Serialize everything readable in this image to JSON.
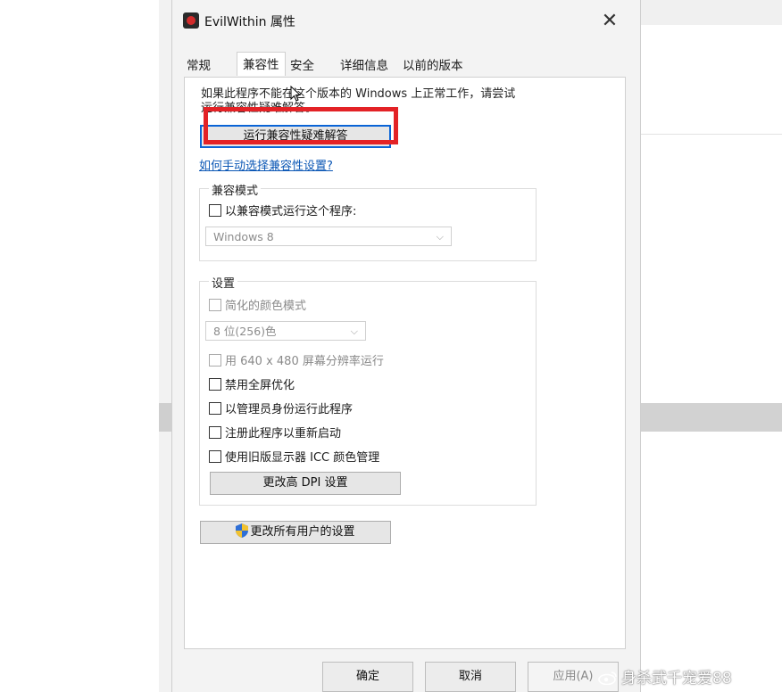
{
  "dialog": {
    "title": "EvilWithin 属性",
    "close_glyph": "✕"
  },
  "tabs": [
    {
      "label": "常规"
    },
    {
      "label": "兼容性"
    },
    {
      "label": "安全"
    },
    {
      "label": "详细信息"
    },
    {
      "label": "以前的版本"
    }
  ],
  "active_tab": "兼容性",
  "compat": {
    "intro_line1": "如果此程序不能在这个版本的 Windows 上正常工作，请尝试",
    "intro_line2": "运行兼容性疑难解答。",
    "troubleshoot_button": "运行兼容性疑难解答",
    "manual_link": "如何手动选择兼容性设置?",
    "mode_group_title": "兼容模式",
    "mode_checkbox": "以兼容模式运行这个程序:",
    "mode_checked": false,
    "mode_select": "Windows 8"
  },
  "settings": {
    "group_title": "设置",
    "reduced_color": "简化的颜色模式",
    "color_select": "8 位(256)色",
    "res_640": "用 640 x 480 屏幕分辨率运行",
    "disable_fullscreen": "禁用全屏优化",
    "run_as_admin": "以管理员身份运行此程序",
    "register_restart": "注册此程序以重新启动",
    "legacy_icc": "使用旧版显示器 ICC 颜色管理",
    "dpi_button": "更改高 DPI 设置"
  },
  "all_users_button": "更改所有用户的设置",
  "footer": {
    "ok": "确定",
    "cancel": "取消",
    "apply": "应用(A)"
  },
  "watermark": "身杀武千宠爱88",
  "colors": {
    "highlight": "#e32226",
    "link": "#0b57b5",
    "focus_border": "#0a64d6"
  }
}
